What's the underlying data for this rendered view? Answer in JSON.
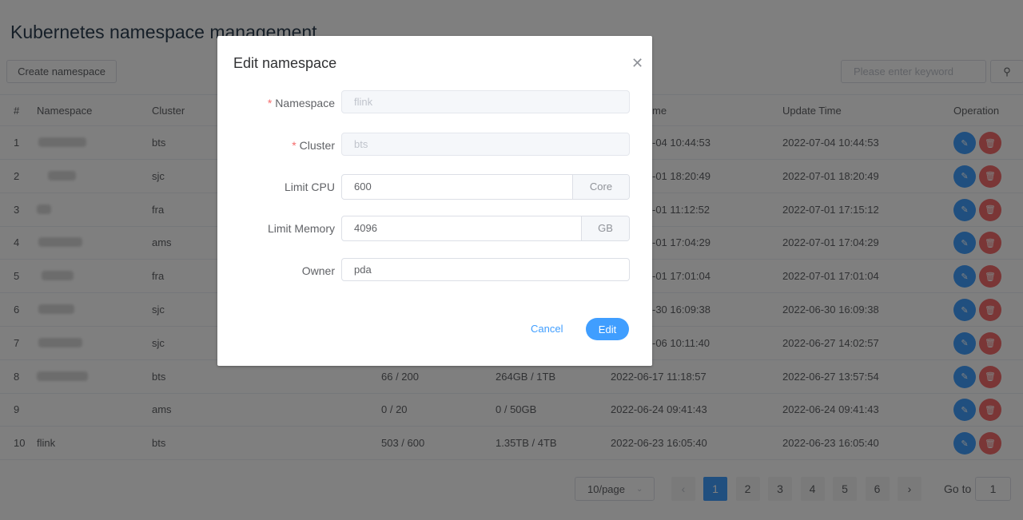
{
  "page": {
    "title": "Kubernetes namespace management",
    "create_button": "Create namespace",
    "search_placeholder": "Please enter keyword"
  },
  "table": {
    "headers": {
      "index": "#",
      "namespace": "Namespace",
      "cluster": "Cluster",
      "create_time_fragment": "me",
      "update_time": "Update Time",
      "operation": "Operation"
    },
    "rows": [
      {
        "index": "1",
        "namespace": "",
        "cluster": "bts",
        "cpu": "",
        "memory": "",
        "create_time": "-04 10:44:53",
        "update_time": "2022-07-04 10:44:53"
      },
      {
        "index": "2",
        "namespace": "",
        "cluster": "sjc",
        "cpu": "",
        "memory": "",
        "create_time": "-01 18:20:49",
        "update_time": "2022-07-01 18:20:49"
      },
      {
        "index": "3",
        "namespace": "",
        "cluster": "fra",
        "cpu": "",
        "memory": "",
        "create_time": "-01 11:12:52",
        "update_time": "2022-07-01 17:15:12"
      },
      {
        "index": "4",
        "namespace": "",
        "cluster": "ams",
        "cpu": "",
        "memory": "",
        "create_time": "-01 17:04:29",
        "update_time": "2022-07-01 17:04:29"
      },
      {
        "index": "5",
        "namespace": "",
        "cluster": "fra",
        "cpu": "",
        "memory": "",
        "create_time": "-01 17:01:04",
        "update_time": "2022-07-01 17:01:04"
      },
      {
        "index": "6",
        "namespace": "",
        "cluster": "sjc",
        "cpu": "",
        "memory": "",
        "create_time": "-30 16:09:38",
        "update_time": "2022-06-30 16:09:38"
      },
      {
        "index": "7",
        "namespace": "",
        "cluster": "sjc",
        "cpu": "",
        "memory": "",
        "create_time": "-06 10:11:40",
        "update_time": "2022-06-27 14:02:57"
      },
      {
        "index": "8",
        "namespace": "",
        "cluster": "bts",
        "cpu": "66 / 200",
        "memory": "264GB / 1TB",
        "create_time": "2022-06-17 11:18:57",
        "update_time": "2022-06-27 13:57:54"
      },
      {
        "index": "9",
        "namespace": "",
        "cluster": "ams",
        "cpu": "0 / 20",
        "memory": "0 / 50GB",
        "create_time": "2022-06-24 09:41:43",
        "update_time": "2022-06-24 09:41:43"
      },
      {
        "index": "10",
        "namespace": "flink",
        "cluster": "bts",
        "cpu": "503 / 600",
        "memory": "1.35TB / 4TB",
        "create_time": "2022-06-23 16:05:40",
        "update_time": "2022-06-23 16:05:40"
      }
    ]
  },
  "pagination": {
    "page_size": "10/page",
    "pages": [
      "1",
      "2",
      "3",
      "4",
      "5",
      "6"
    ],
    "current": "1",
    "goto_label": "Go to",
    "goto_value": "1"
  },
  "modal": {
    "title": "Edit namespace",
    "fields": {
      "namespace": {
        "label": "Namespace",
        "value": "flink",
        "required": true
      },
      "cluster": {
        "label": "Cluster",
        "value": "bts",
        "required": true
      },
      "cpu": {
        "label": "Limit CPU",
        "value": "600",
        "unit": "Core"
      },
      "memory": {
        "label": "Limit Memory",
        "value": "4096",
        "unit": "GB"
      },
      "owner": {
        "label": "Owner",
        "value": "pda"
      }
    },
    "cancel": "Cancel",
    "submit": "Edit"
  },
  "colors": {
    "primary": "#409eff",
    "danger": "#f56c6c",
    "required": "#f56c6c"
  },
  "icons": {
    "close": "close-icon",
    "search": "search-icon",
    "edit": "edit-icon",
    "delete": "trash-icon"
  }
}
